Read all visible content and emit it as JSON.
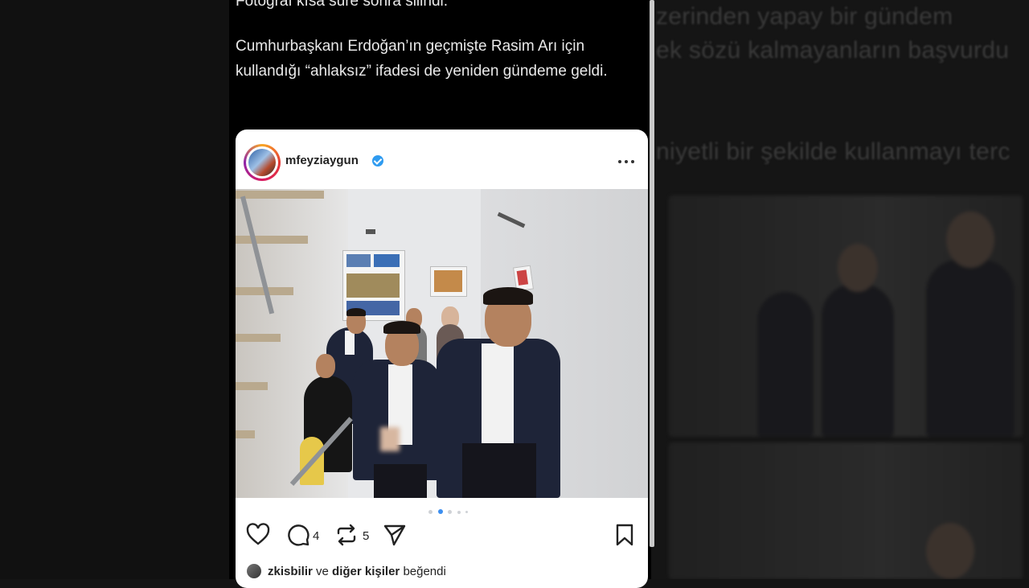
{
  "background": {
    "blurred_lines": [
      "zerinden yapay bir gündem",
      "ek sözü kalmayanların başvurdu",
      "niyetli bir şekilde kullanmayı terc"
    ]
  },
  "post": {
    "text_line_1": "Fotoğraf kısa süre sonra silindi.",
    "text_para_2": "Cumhurbaşkanı Erdoğan’ın geçmişte Rasim Arı için kullandığı “ahlaksız” ifadesi de yeniden gündeme geldi."
  },
  "embed": {
    "username": "mfeyziaygun",
    "verified_icon": "verified-badge-icon",
    "more_icon": "more-dots-icon",
    "carousel": {
      "total": 5,
      "active_index": 1
    },
    "actions": {
      "like_icon": "heart-icon",
      "comment_icon": "comment-icon",
      "comment_count": "4",
      "repost_icon": "repost-icon",
      "repost_count": "5",
      "share_icon": "send-icon",
      "save_icon": "bookmark-icon"
    },
    "liked_by": {
      "user": "zkisbilir",
      "connector": "ve",
      "others": "diğer kişiler",
      "suffix": "beğendi"
    }
  },
  "colors": {
    "page_bg": "#000000",
    "card_bg": "#ffffff",
    "verified_blue": "#2f9bf0",
    "carousel_active": "#3d8ff0"
  }
}
